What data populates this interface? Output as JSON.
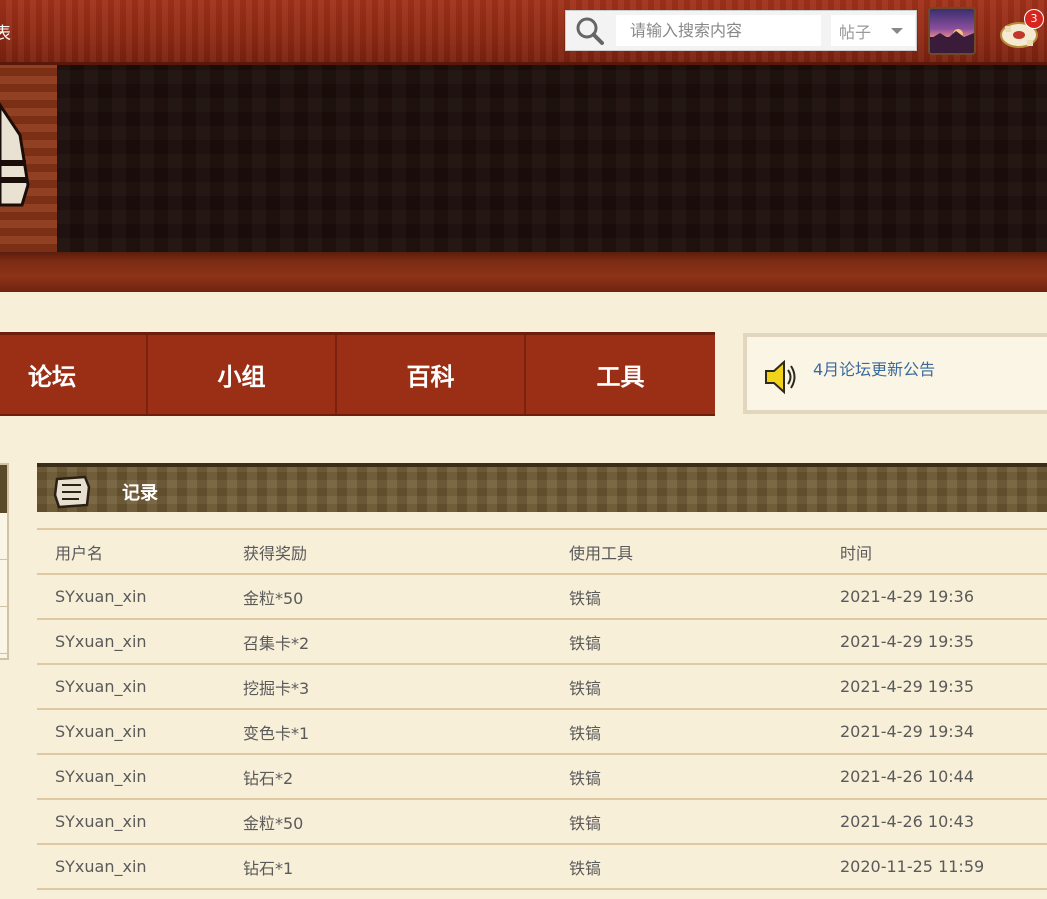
{
  "topbar": {
    "left_text": "表",
    "search": {
      "placeholder": "请输入搜索内容",
      "type_selected": "帖子"
    },
    "notification_count": "3"
  },
  "nav": {
    "items": [
      {
        "label": "论坛"
      },
      {
        "label": "小组"
      },
      {
        "label": "百科"
      },
      {
        "label": "工具"
      }
    ]
  },
  "announcement": {
    "link_text": "4月论坛更新公告"
  },
  "record": {
    "title": "记录",
    "columns": [
      "用户名",
      "获得奖励",
      "使用工具",
      "时间"
    ],
    "rows": [
      [
        "SYxuan_xin",
        "金粒*50",
        "铁镐",
        "2021-4-29 19:36"
      ],
      [
        "SYxuan_xin",
        "召集卡*2",
        "铁镐",
        "2021-4-29 19:35"
      ],
      [
        "SYxuan_xin",
        "挖掘卡*3",
        "铁镐",
        "2021-4-29 19:35"
      ],
      [
        "SYxuan_xin",
        "变色卡*1",
        "铁镐",
        "2021-4-29 19:34"
      ],
      [
        "SYxuan_xin",
        "钻石*2",
        "铁镐",
        "2021-4-26 10:44"
      ],
      [
        "SYxuan_xin",
        "金粒*50",
        "铁镐",
        "2021-4-26 10:43"
      ],
      [
        "SYxuan_xin",
        "钻石*1",
        "铁镐",
        "2020-11-25 11:59"
      ]
    ]
  },
  "colors": {
    "topbar": "#9a2f16",
    "nav": "#9a2f16",
    "page_background": "#f8efd9",
    "link": "#3a6a9c"
  }
}
